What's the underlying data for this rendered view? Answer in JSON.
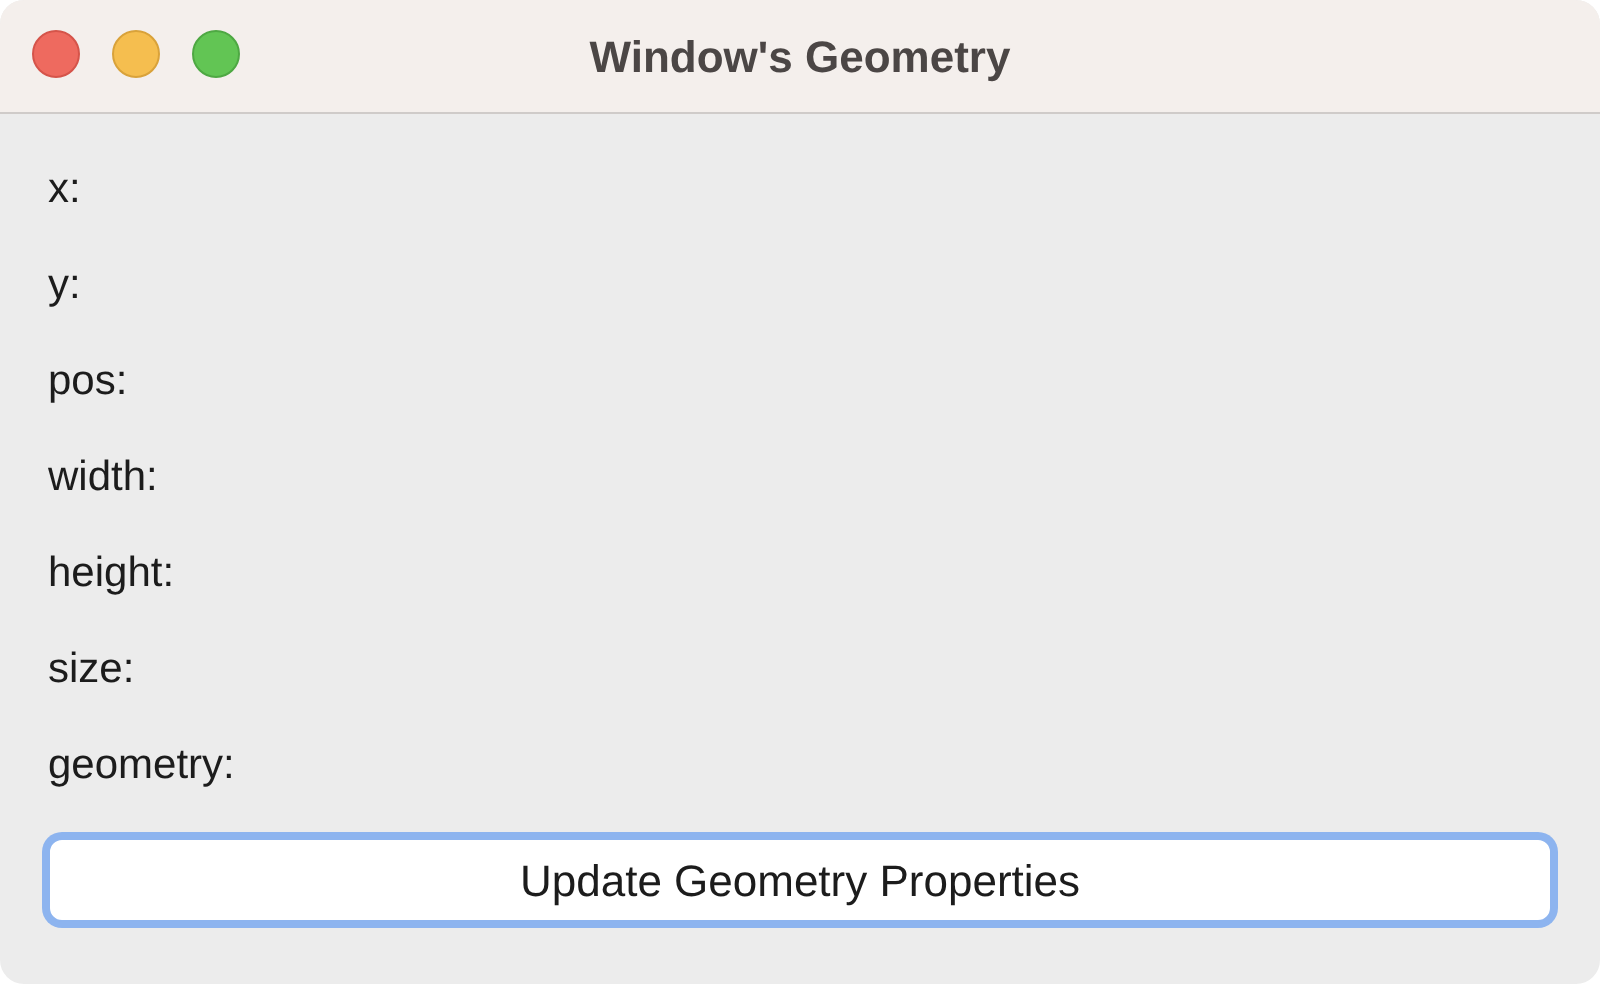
{
  "window": {
    "title": "Window's Geometry"
  },
  "labels": [
    "x:",
    "y:",
    "pos:",
    "width:",
    "height:",
    "size:",
    "geometry:"
  ],
  "button": {
    "label": "Update Geometry Properties",
    "focused": true
  }
}
